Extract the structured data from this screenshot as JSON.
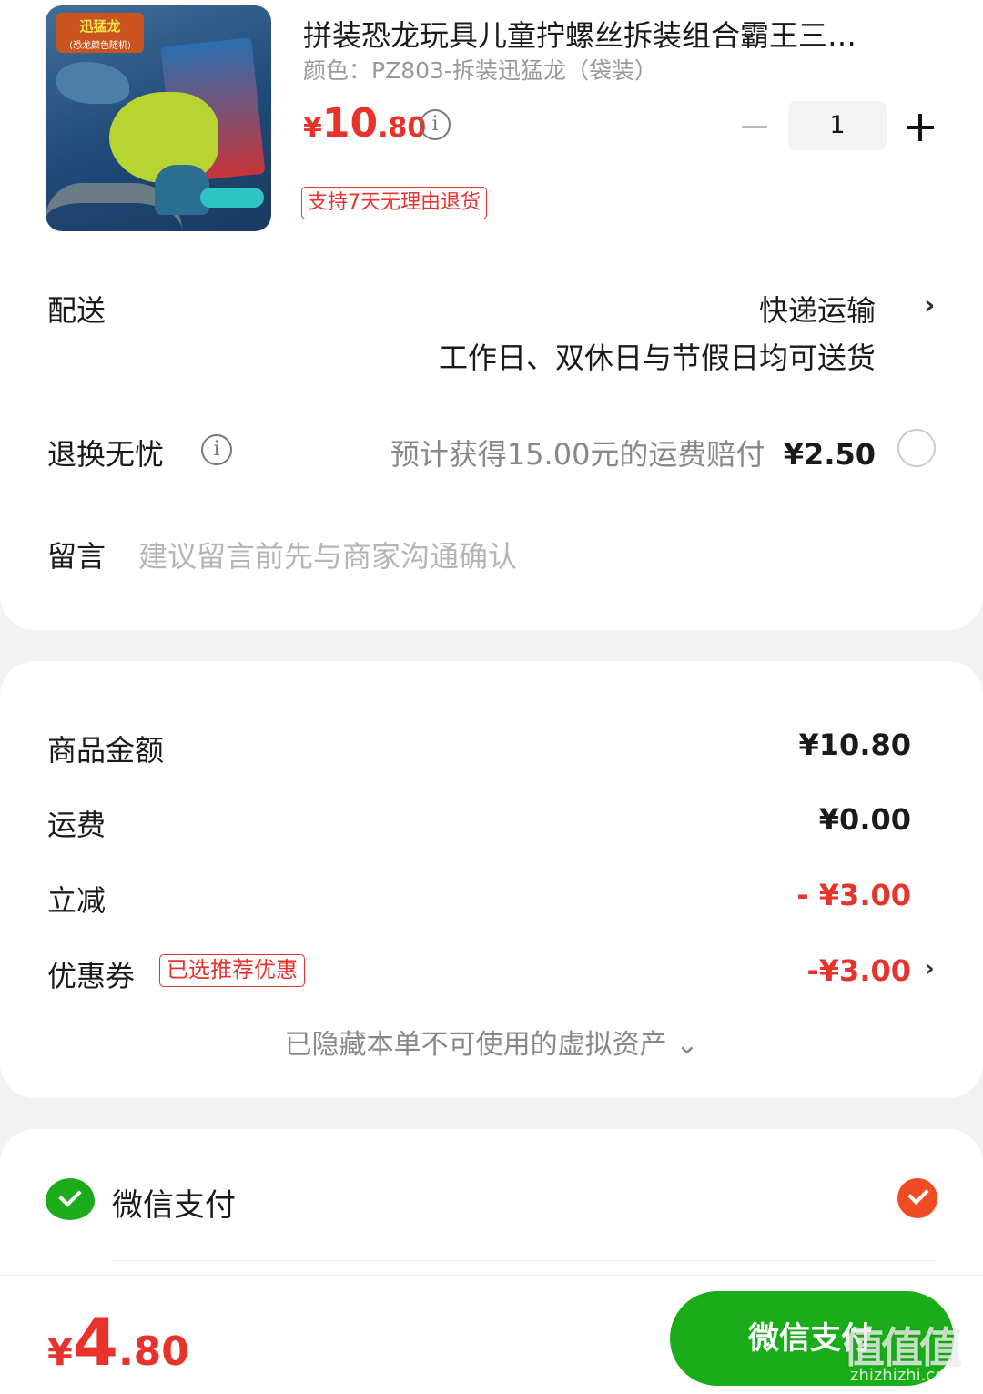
{
  "product": {
    "title": "拼装恐龙玩具儿童拧螺丝拆装组合霸王三…",
    "variant": "颜色：PZ803-拆装迅猛龙（袋装）",
    "price_currency": "¥",
    "price_int": "10",
    "price_dec": ".80",
    "quantity": "1",
    "return_tag": "支持7天无理由退货",
    "thumb_badge": "迅猛龙",
    "thumb_badge_sub": "(恐龙颜色随机)"
  },
  "delivery": {
    "label": "配送",
    "method": "快递运输",
    "note": "工作日、双休日与节假日均可送货"
  },
  "return_worry_free": {
    "label": "退换无忧",
    "compensation_text": "预计获得15.00元的运费赔付",
    "price": "¥2.50"
  },
  "message": {
    "label": "留言",
    "placeholder": "建议留言前先与商家沟通确认"
  },
  "summary": {
    "goods_label": "商品金额",
    "goods_value": "¥10.80",
    "shipping_label": "运费",
    "shipping_value": "¥0.00",
    "discount_label": "立减",
    "discount_value": "- ¥3.00",
    "coupon_label": "优惠券",
    "coupon_tag": "已选推荐优惠",
    "coupon_value": "-¥3.00",
    "hidden_assets": "已隐藏本单不可使用的虚拟资产 ⌄"
  },
  "payment": {
    "method_label": "微信支付",
    "selected": true
  },
  "footer": {
    "total_currency": "¥",
    "total_int": "4",
    "total_dec": ".80",
    "pay_button": "微信支付"
  },
  "watermark": {
    "logo": "值值值",
    "url": "zhizhizhi.com"
  },
  "colors": {
    "accent_red": "#e8332c",
    "wechat_green": "#1aad19",
    "check_orange": "#f04b23"
  }
}
